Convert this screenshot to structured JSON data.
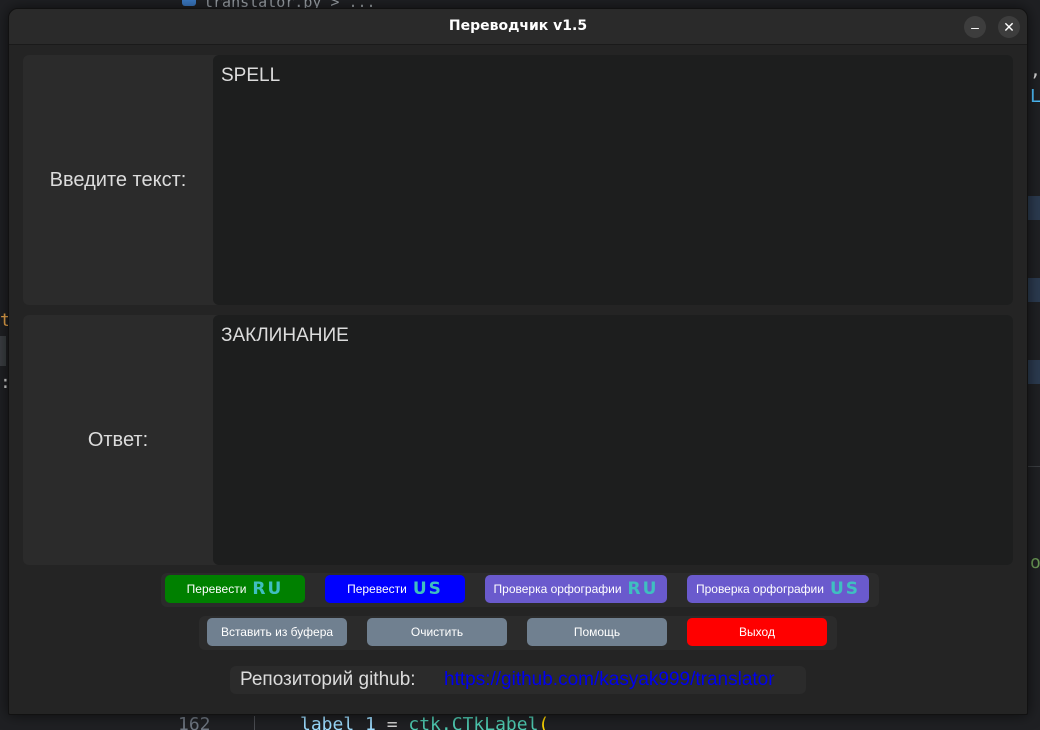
{
  "editor": {
    "top_breadcrumb": "translator.py  >  ...",
    "bottom_line_number": "162",
    "bottom_code_var": "label_1",
    "bottom_code_eq": " = ",
    "bottom_code_call": "ctk.CTkLabel",
    "bottom_code_paren": "(",
    "right_glyph_1": ",",
    "right_glyph_2": "L",
    "right_glyph_3": "o",
    "left_glyph_1": "t",
    "left_glyph_2": ":"
  },
  "window": {
    "title": "Переводчик v1.5",
    "minimize_glyph": "–",
    "close_glyph": "✕"
  },
  "input_panel": {
    "label": "Введите текст:",
    "value": "SPELL"
  },
  "output_panel": {
    "label": "Ответ:",
    "value": "ЗАКЛИНАНИЕ"
  },
  "buttons_row1": [
    {
      "label": "Перевести",
      "flag": "RU",
      "bg": "#008000",
      "flag_color": "#3fbfc0"
    },
    {
      "label": "Перевести",
      "flag": "US",
      "bg": "#0000ff",
      "flag_color": "#3fbfc0"
    },
    {
      "label": "Проверка орфографии",
      "flag": "RU",
      "bg": "#6a5acd",
      "flag_color": "#3fbfc0"
    },
    {
      "label": "Проверка орфографии",
      "flag": "US",
      "bg": "#6a5acd",
      "flag_color": "#3fbfc0"
    }
  ],
  "buttons_row2": [
    {
      "label": "Вставить из буфера",
      "bg": "#708090"
    },
    {
      "label": "Очистить",
      "bg": "#708090"
    },
    {
      "label": "Помощь",
      "bg": "#708090"
    },
    {
      "label": "Выход",
      "bg": "#ff0000"
    }
  ],
  "repo": {
    "label": "Репозиторий github:",
    "link": "https://github.com/kasyak999/translator"
  }
}
